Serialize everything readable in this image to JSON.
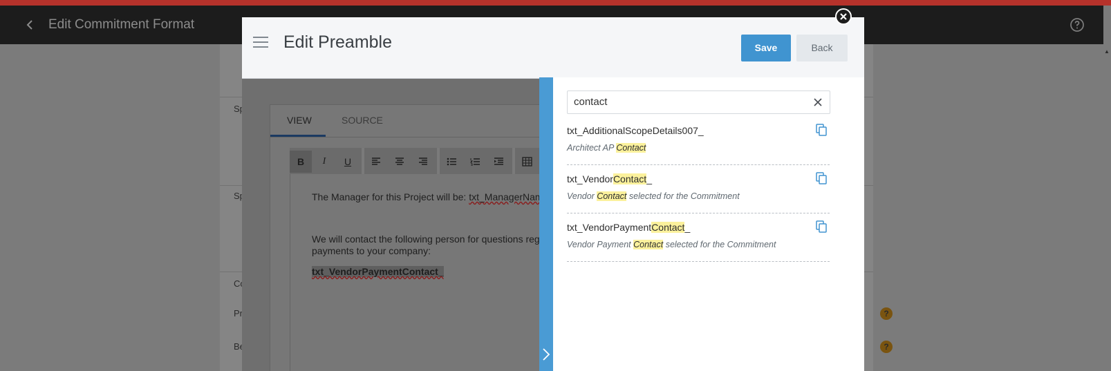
{
  "app": {
    "title": "Edit Commitment Format"
  },
  "background": {
    "labels": [
      "Sp",
      "Sp",
      "Co",
      "Pr",
      "Be"
    ]
  },
  "modal": {
    "title": "Edit Preamble",
    "save_label": "Save",
    "back_label": "Back"
  },
  "editor": {
    "tabs": [
      "VIEW",
      "SOURCE"
    ],
    "line1_prefix": "The Manager for this Project will be: ",
    "line1_token": "txt_ManagerName_",
    "line2": "We will contact the following person for questions regar",
    "line3": "payments to your company:",
    "line4_token": "txt_VendorPaymentContact_"
  },
  "search": {
    "value": "contact"
  },
  "results": [
    {
      "name_prefix": "txt_AdditionalScopeDetails007_",
      "name_match": "",
      "name_suffix": "",
      "desc_prefix": "Architect AP ",
      "desc_match": "Contact",
      "desc_suffix": ""
    },
    {
      "name_prefix": "txt_Vendor",
      "name_match": "Contact",
      "name_suffix": "_",
      "desc_prefix": "Vendor ",
      "desc_match": "Contact",
      "desc_suffix": " selected for the Commitment"
    },
    {
      "name_prefix": "txt_VendorPayment",
      "name_match": "Contact",
      "name_suffix": "_",
      "desc_prefix": "Vendor Payment ",
      "desc_match": "Contact",
      "desc_suffix": " selected for the Commitment"
    }
  ],
  "colors": {
    "accent": "#4094d0",
    "highlight": "#fbf19c"
  }
}
